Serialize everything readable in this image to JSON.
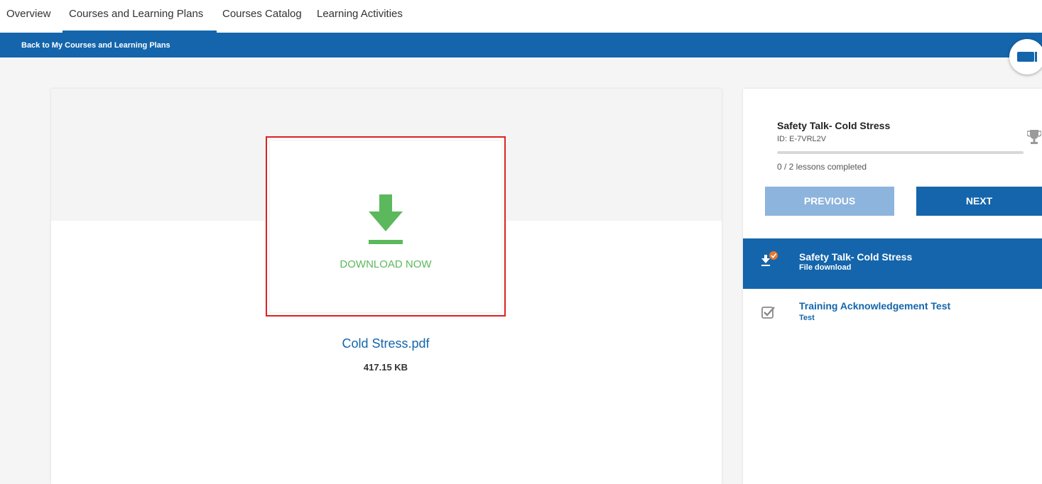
{
  "tabs": [
    {
      "label": "Overview"
    },
    {
      "label": "Courses and Learning Plans",
      "active": true
    },
    {
      "label": "Courses Catalog"
    },
    {
      "label": "Learning Activities"
    }
  ],
  "header": {
    "back_label": "Back to My Courses and Learning Plans"
  },
  "player": {
    "download_label": "DOWNLOAD NOW",
    "file_name": "Cold Stress.pdf",
    "file_size": "417.15 KB"
  },
  "sidebar": {
    "course_title": "Safety Talk- Cold Stress",
    "course_id": "ID: E-7VRL2V",
    "progress_fraction": 0,
    "lessons_completed": "0 / 2 lessons completed",
    "previous_label": "PREVIOUS",
    "next_label": "NEXT",
    "lessons": [
      {
        "title": "Safety Talk- Cold Stress",
        "type": "File download",
        "icon": "download-icon",
        "active": true
      },
      {
        "title": "Training Acknowledgement Test",
        "type": "Test",
        "icon": "test-checkbox-icon",
        "active": false
      }
    ]
  },
  "colors": {
    "brand": "#1465ab",
    "download_green": "#5cb85c",
    "status_orange": "#e8782e",
    "highlight_red": "#e02020"
  }
}
